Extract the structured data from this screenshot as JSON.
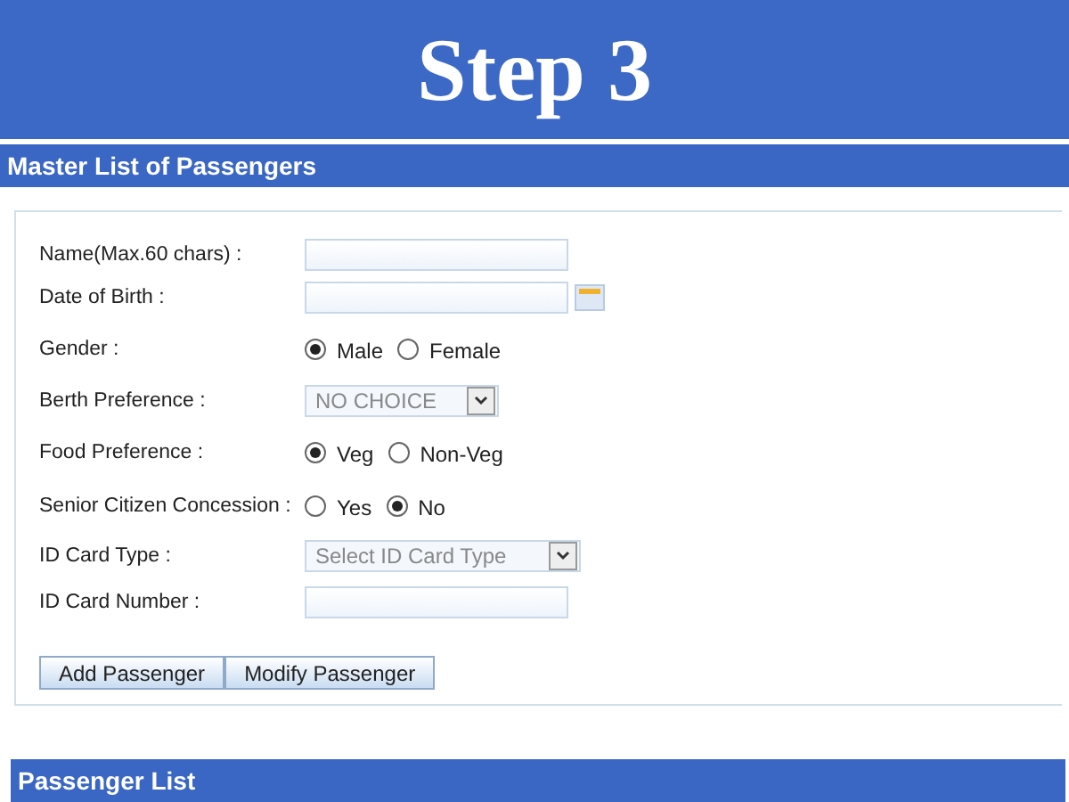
{
  "banner": {
    "title": "Step 3"
  },
  "section": {
    "title": "Master List of Passengers"
  },
  "form": {
    "rows": [
      {
        "kind": "text",
        "label": "Name(Max.60 chars) :"
      },
      {
        "kind": "date",
        "label": "Date of Birth :"
      },
      {
        "kind": "radio",
        "label": "Gender :",
        "options": [
          {
            "label": "Male",
            "selected": true
          },
          {
            "label": "Female",
            "selected": false
          }
        ]
      },
      {
        "kind": "select",
        "label": "Berth Preference :",
        "value": "NO CHOICE"
      },
      {
        "kind": "radio",
        "label": "Food Preference :",
        "options": [
          {
            "label": "Veg",
            "selected": true
          },
          {
            "label": "Non-Veg",
            "selected": false
          }
        ]
      },
      {
        "kind": "radio",
        "label": "Senior Citizen Concession :",
        "options": [
          {
            "label": "Yes",
            "selected": false
          },
          {
            "label": "No",
            "selected": true
          }
        ]
      },
      {
        "kind": "select",
        "label": "ID Card Type :",
        "value": "Select ID Card Type",
        "wide": true
      },
      {
        "kind": "text",
        "label": "ID Card Number :"
      }
    ],
    "buttons": [
      "Add Passenger",
      "Modify Passenger"
    ]
  },
  "passenger_list": {
    "title": "Passenger List"
  }
}
